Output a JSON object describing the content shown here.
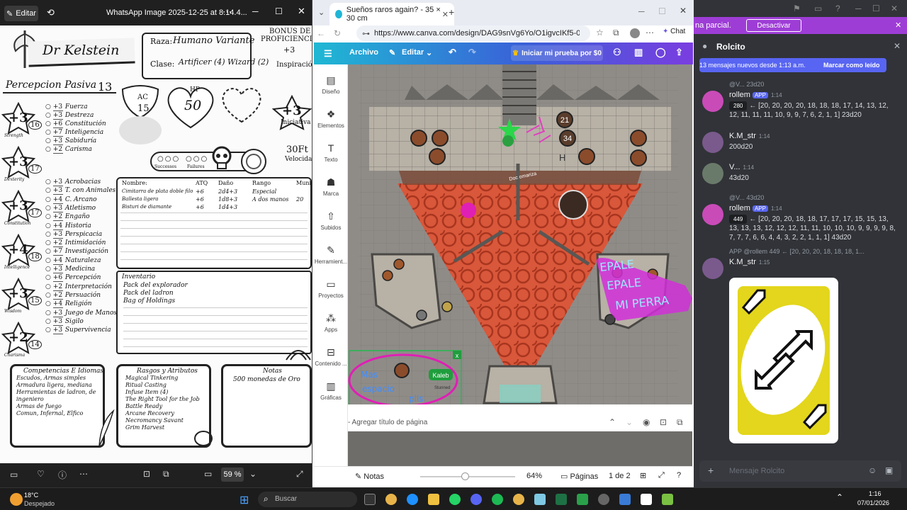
{
  "viewer": {
    "edit_label": "Editar",
    "title": "WhatsApp Image 2025-12-25 at 8.14.4...",
    "zoom": "59 %"
  },
  "sheet": {
    "name": "Dr Kelstein",
    "race_label": "Raza:",
    "race": "Humano Variante",
    "class_label": "Clase:",
    "class": "Artificer (4) Wizard (2)",
    "bonus_label1": "BONUS DE",
    "bonus_label2": "PROFICIENCIA",
    "bonus_value": "+3",
    "inspiration": "Inspiración",
    "passive_label": "Percepcion Pasiva",
    "passive_value": "13",
    "ac_label": "AC",
    "ac_value": "15",
    "hp_label": "HP",
    "hp_value": "50",
    "initiative_value": "+3",
    "initiative_label": "Iniciativa",
    "speed_value": "30Ft",
    "speed_label": "Velocidad",
    "successes": "Successes",
    "failures": "Failures",
    "stats": [
      {
        "mod": "+3",
        "score": "16",
        "label": "Strength"
      },
      {
        "mod": "+3",
        "score": "17",
        "label": "Dexterity"
      },
      {
        "mod": "+3",
        "score": "17",
        "label": "Constitution"
      },
      {
        "mod": "+4",
        "score": "18",
        "label": "Intelligence"
      },
      {
        "mod": "+3",
        "score": "15",
        "label": "Wisdom"
      },
      {
        "mod": "+2",
        "score": "14",
        "label": "Charisma"
      }
    ],
    "saves": [
      {
        "v": "+3",
        "n": "Fuerza"
      },
      {
        "v": "+3",
        "n": "Destreza"
      },
      {
        "v": "+6",
        "n": "Constitución"
      },
      {
        "v": "+7",
        "n": "Inteligencia"
      },
      {
        "v": "+3",
        "n": "Sabiduría"
      },
      {
        "v": "+2",
        "n": "Carisma"
      }
    ],
    "skills": [
      {
        "v": "+3",
        "n": "Acrobacias"
      },
      {
        "v": "+3",
        "n": "T. con Animales"
      },
      {
        "v": "+4",
        "n": "C. Arcano"
      },
      {
        "v": "+3",
        "n": "Atletismo"
      },
      {
        "v": "+2",
        "n": "Engaño"
      },
      {
        "v": "+4",
        "n": "Historia"
      },
      {
        "v": "+3",
        "n": "Perspicacia"
      },
      {
        "v": "+2",
        "n": "Intimidación"
      },
      {
        "v": "+7",
        "n": "Investigación"
      },
      {
        "v": "+4",
        "n": "Naturaleza"
      },
      {
        "v": "+3",
        "n": "Medicina"
      },
      {
        "v": "+6",
        "n": "Percepción"
      },
      {
        "v": "+2",
        "n": "Interpretación"
      },
      {
        "v": "+2",
        "n": "Persuación"
      },
      {
        "v": "+4",
        "n": "Religión"
      },
      {
        "v": "+3",
        "n": "Juego de Manos"
      },
      {
        "v": "+3",
        "n": "Sigilo"
      },
      {
        "v": "+3",
        "n": "Supervivencia"
      }
    ],
    "attacks_headers": [
      "Nombre:",
      "ATQ",
      "Daño",
      "Rango",
      "Munición"
    ],
    "attacks": [
      [
        "Cimitarra de plata doble filo",
        "+6",
        "2d4+3",
        "Especial",
        ""
      ],
      [
        "Ballesta ligera",
        "+6",
        "1d8+3",
        "A dos manos",
        "20"
      ],
      [
        "Bisturi de diamante",
        "+6",
        "1d4+3",
        "",
        ""
      ]
    ],
    "inventory_title": "Inventario",
    "inventory": [
      "Pack del explorador",
      "Pack del ladron",
      "Bag of Holdings"
    ],
    "prof_title": "Competencias E Idiomas",
    "prof": [
      "Escudos, Armas simples",
      "Armadura ligera, mediana",
      "Herramientas de ladron, de",
      "ingeniero",
      "Armas de fuego",
      "Comun, Infernal, Elfico"
    ],
    "traits_title": "Rasgos y Atributos",
    "traits": [
      "Magical Tinkering",
      "Ritual Casting",
      "Infuse Item (4)",
      "The Right Tool for the Job",
      "Battle Ready",
      "Arcane Recovery",
      "Necromancy Savant",
      "Grim Harvest"
    ],
    "notes_title": "Notas",
    "notes": "500 monedas de Oro"
  },
  "browser": {
    "tab_title": "Sueños raros again? - 35 × 30 cm",
    "url": "https://www.canva.com/design/DAG9snVg6Yo/O1igvcIKf5-0ktVLWBnI...",
    "chat_label": "Chat"
  },
  "canva": {
    "menu_archivo": "Archivo",
    "menu_editar": "Editar",
    "trial_button": "Iniciar mi prueba por $0",
    "sidebar": [
      "Diseño",
      "Elementos",
      "Texto",
      "Marca",
      "Subidos",
      "Herramient...",
      "Proyectos",
      "Apps",
      "Contenido ...",
      "Gráficas"
    ],
    "token_21": "21",
    "token_34": "34",
    "token_label_h": "H",
    "token_name_kaleb": "Kaleb",
    "token_status_stunned": "Stunned",
    "doc_label": "Doc omariza",
    "handwriting_epale1": "EPALE",
    "handwriting_epale2": "EPALE",
    "handwriting_miperra": "MI PERRA",
    "handwriting_mas": "Mas",
    "handwriting_espacio": "espacio",
    "handwriting_plis": "plis",
    "page_title_placeholder": "- Agregar título de página",
    "notes_label": "Notas",
    "zoom": "64%",
    "pages_label": "Páginas",
    "pages_count": "1 de 2"
  },
  "discord": {
    "notice_text": "na parcial.",
    "notice_button": "Desactivar",
    "channel": "Rolcito",
    "new_messages": "13 mensajes nuevos desde 1:13 a.m.",
    "mark_read": "Marcar como leído",
    "input_placeholder": "Mensaje Rolcito",
    "messages": [
      {
        "reply": "@V... 23d20",
        "author": "rollem",
        "app": "APP",
        "time": "1:14",
        "count": "280",
        "text": "← [20, 20, 20, 20, 18, 18, 18, 17, 14, 13, 12, 12, 11, 11, 11, 10, 9, 9, 7, 6, 2, 1, 1] 23d20"
      },
      {
        "author": "K.M_str",
        "time": "1:14",
        "text": "200d20"
      },
      {
        "author": "V...",
        "time": "1:14",
        "text": "43d20"
      },
      {
        "reply": "@V... 43d20",
        "author": "rollem",
        "app": "APP",
        "time": "1:14",
        "count": "449",
        "text": "← [20, 20, 20, 18, 18, 17, 17, 17, 15, 15, 13, 13, 13, 13, 12, 12, 12, 11, 11, 10, 10, 10, 9, 9, 9, 9, 8, 7, 7, 7, 6, 6, 4, 4, 3, 2, 2, 1, 1, 1] 43d20"
      },
      {
        "reply": "APP @rollem 449 ← [20, 20, 20, 18, 18, 18, 1...",
        "author": "K.M_str",
        "time": "1:15"
      }
    ]
  },
  "taskbar": {
    "weather_temp": "18°C",
    "weather_desc": "Despejado",
    "search": "Buscar",
    "time": "1:16",
    "date": "07/01/2026"
  },
  "colors": {
    "canva_gradient_start": "#1fb8d4",
    "canva_gradient_end": "#7a3de0",
    "discord_bg": "#313338",
    "discord_notice": "#9e3dd6",
    "blurple": "#5865f2",
    "lava": "#d9573a",
    "uno_yellow": "#e3d61c"
  }
}
